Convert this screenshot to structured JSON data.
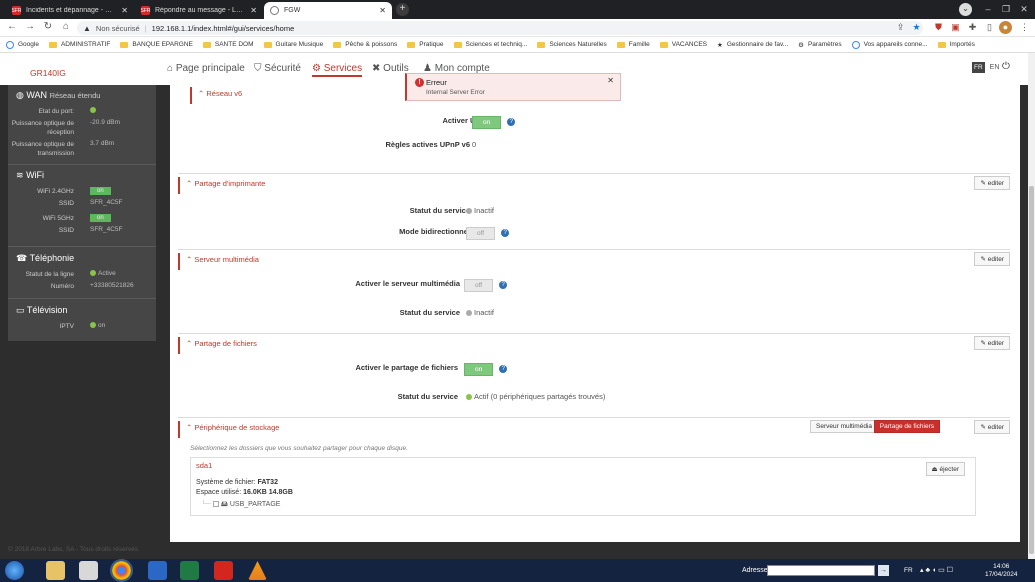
{
  "browser": {
    "tabs": [
      {
        "title": "Incidents et dépannage - Mon E",
        "favicon": "SFR"
      },
      {
        "title": "Répondre au message - La Com",
        "favicon": "SFR"
      },
      {
        "title": "FGW",
        "favicon": "globe-icon"
      }
    ],
    "security": "Non sécurisé",
    "url": "192.168.1.1/index.html#/gui/services/home",
    "bookmarks": [
      {
        "label": "Google",
        "type": "google"
      },
      {
        "label": "ADMINISTRATIF",
        "type": "folder"
      },
      {
        "label": "BANQUE EPARGNE",
        "type": "folder"
      },
      {
        "label": "SANTE DOM",
        "type": "folder"
      },
      {
        "label": "Guitare Musique",
        "type": "folder"
      },
      {
        "label": "Pêche & poissons",
        "type": "folder"
      },
      {
        "label": "Pratique",
        "type": "folder"
      },
      {
        "label": "Sciences et techniq...",
        "type": "folder"
      },
      {
        "label": "Sciences Naturelles",
        "type": "folder"
      },
      {
        "label": "Famille",
        "type": "folder"
      },
      {
        "label": "VACANCES",
        "type": "folder"
      },
      {
        "label": "Gestionnaire de fav...",
        "type": "star"
      },
      {
        "label": "Paramètres",
        "type": "gear"
      },
      {
        "label": "Vos appareils conne...",
        "type": "google"
      },
      {
        "label": "Importés",
        "type": "folder"
      }
    ]
  },
  "app": {
    "brand": "GR140IG",
    "nav": [
      {
        "label": "Page principale",
        "icon": "home-icon"
      },
      {
        "label": "Sécurité",
        "icon": "shield-icon"
      },
      {
        "label": "Services",
        "icon": "cogs-icon"
      },
      {
        "label": "Outils",
        "icon": "tools-icon"
      },
      {
        "label": "Mon compte",
        "icon": "user-icon"
      }
    ],
    "lang_fr": "FR",
    "lang_en": "EN"
  },
  "sidebar": {
    "wan": {
      "title": "WAN",
      "subtitle": "Réseau étendu",
      "port_label": "Etat du port:",
      "rx_label": "Puissance optique de réception",
      "rx_value": "-20.9 dBm",
      "tx_label": "Puissance optique de transmission",
      "tx_value": "3.7 dBm"
    },
    "wifi": {
      "title": "WiFi",
      "w24_label": "WiFi 2.4GHz",
      "w24_value": "on",
      "ssid1_label": "SSID",
      "ssid1_value": "SFR_4C5F",
      "w5_label": "WiFi 5GHz",
      "w5_value": "on",
      "ssid2_label": "SSID",
      "ssid2_value": "SFR_4C5F"
    },
    "tel": {
      "title": "Téléphonie",
      "line_label": "Statut de la ligne",
      "line_value": "Active",
      "num_label": "Numéro",
      "num_value": "+33380521826"
    },
    "tv": {
      "title": "Télévision",
      "iptv_label": "IPTV",
      "iptv_value": "on"
    }
  },
  "content": {
    "reseau_v6": {
      "title": "Réseau v6",
      "upnp_label": "Activer UPnP",
      "upnp_value": "on",
      "rules_label": "Règles actives UPnP v6",
      "rules_value": "0"
    },
    "printer": {
      "title": "Partage d'imprimante",
      "edit": "editer",
      "status_label": "Statut du service",
      "status_value": "Inactif",
      "bidi_label": "Mode bidirectionnel",
      "bidi_value": "off"
    },
    "media": {
      "title": "Serveur multimédia",
      "edit": "editer",
      "enable_label": "Activer le serveur multimédia",
      "enable_value": "off",
      "status_label": "Statut du service",
      "status_value": "Inactif"
    },
    "files": {
      "title": "Partage de fichiers",
      "edit": "editer",
      "enable_label": "Activer le partage de fichiers",
      "enable_value": "on",
      "status_label": "Statut du service",
      "status_value": "Actif (0 périphériques partagés trouvés)"
    },
    "storage": {
      "title": "Périphérique de stockage",
      "edit": "editer",
      "btn_media": "Serveur multimédia",
      "btn_files": "Partage de fichiers",
      "hint": "Sélectionnez les dossiers que vous souhaitez partager pour chaque disque.",
      "disk": "sda1",
      "eject": "éjecter",
      "fs_label": "Système de fichier:",
      "fs_value": "FAT32",
      "used_label": "Espace utilisé:",
      "used_value": "16.0KB 14.8GB",
      "folder": "USB_PARTAGE"
    }
  },
  "footer": "© 2018 Arbre Labs, SA - Tous droits réservés",
  "toast": {
    "title": "Erreur",
    "message": "Internal Server Error"
  },
  "taskbar": {
    "address_label": "Adresse",
    "lang": "FR",
    "time": "14:06",
    "date": "17/04/2024"
  }
}
